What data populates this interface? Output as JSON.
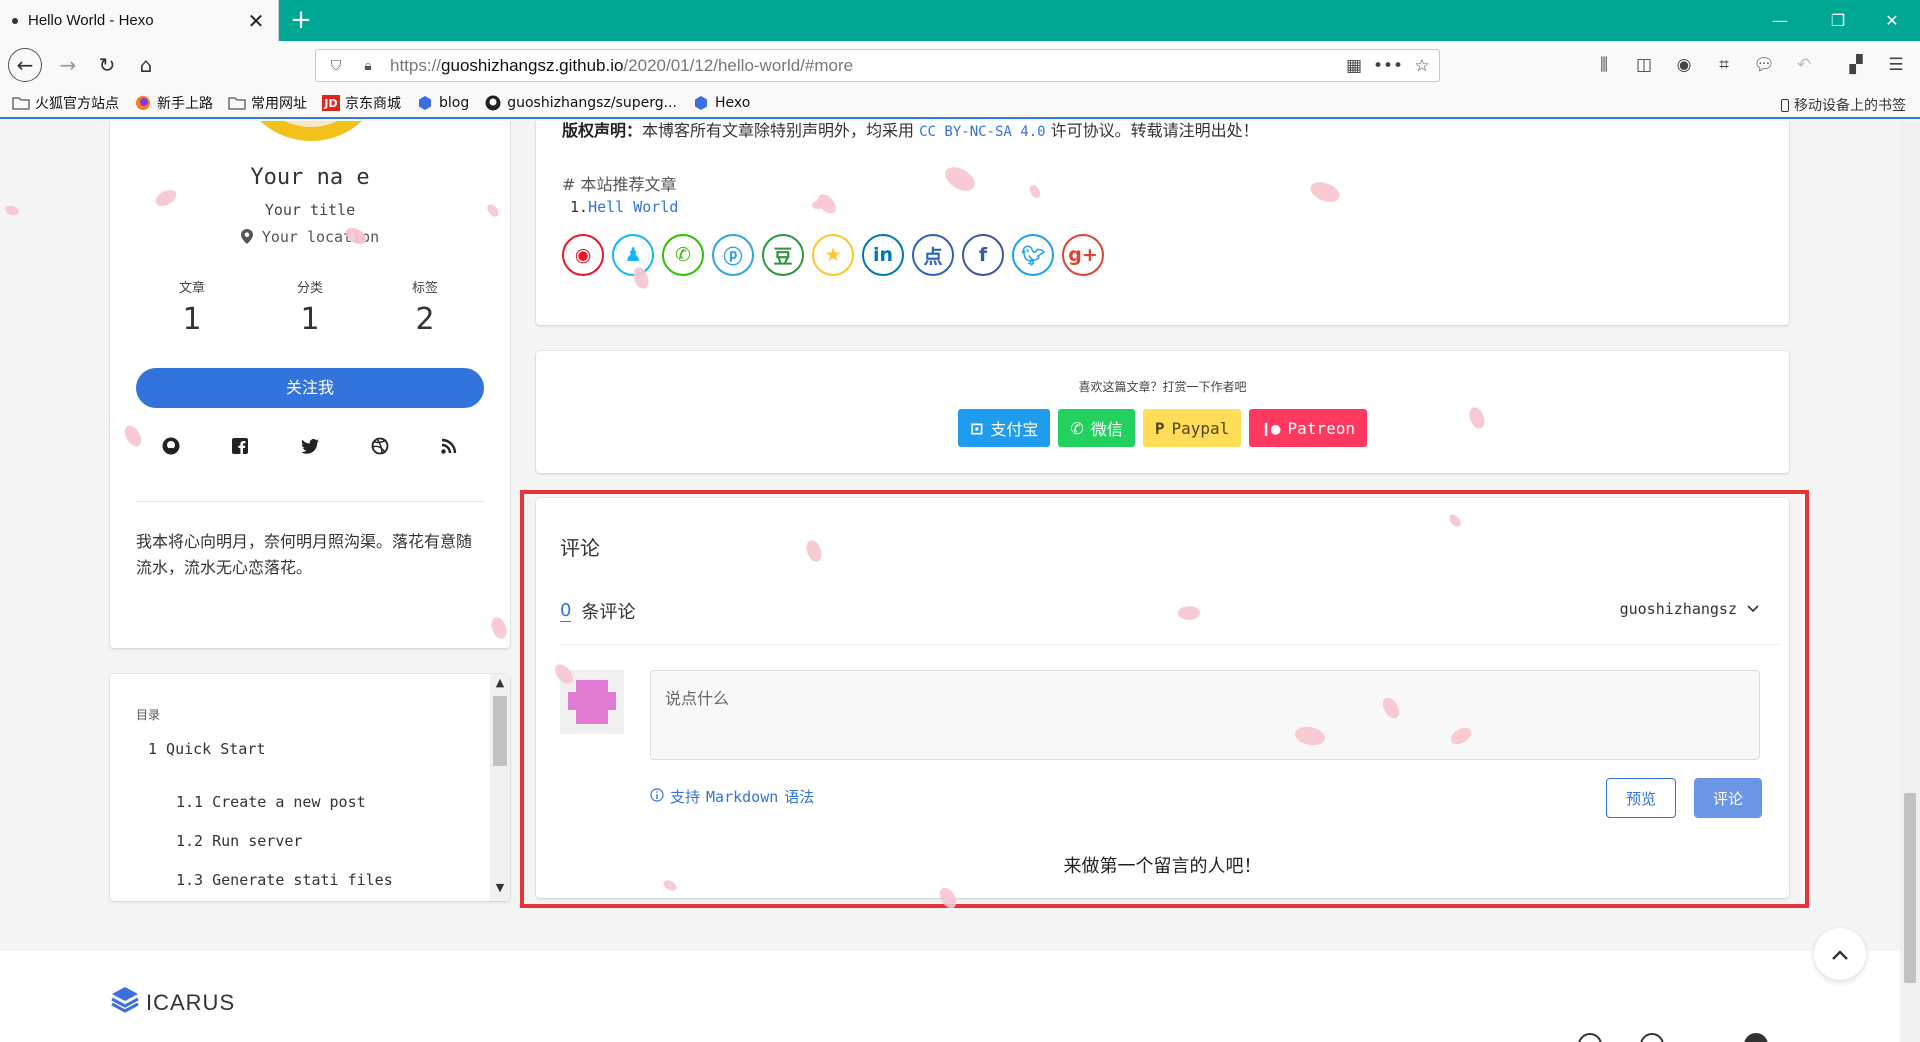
{
  "browser": {
    "tab_title": "Hello World - Hexo",
    "url_prefix": "https://",
    "url_domain": "guoshizhangsz.github.io",
    "url_path": "/2020/01/12/hello-world/#more",
    "bookmarks": [
      {
        "label": "火狐官方站点",
        "icon": "folder-icon"
      },
      {
        "label": "新手上路",
        "icon": "firefox-icon"
      },
      {
        "label": "常用网址",
        "icon": "folder-icon"
      },
      {
        "label": "京东商城",
        "icon": "jd-icon"
      },
      {
        "label": "blog",
        "icon": "hexo-icon"
      },
      {
        "label": "guoshizhangsz/superg...",
        "icon": "github-icon"
      },
      {
        "label": "Hexo",
        "icon": "hexo-icon"
      }
    ],
    "mobile_bookmarks": "移动设备上的书签"
  },
  "profile": {
    "name": "Your na e",
    "title": "Your title",
    "location": "Your location",
    "stats": [
      {
        "label": "文章",
        "value": "1"
      },
      {
        "label": "分类",
        "value": "1"
      },
      {
        "label": "标签",
        "value": "2"
      }
    ],
    "follow_label": "关注我",
    "socials": [
      "github-icon",
      "facebook-icon",
      "twitter-icon",
      "dribbble-icon",
      "rss-icon"
    ],
    "motto": "我本将心向明月，奈何明月照沟渠。落花有意随流水，流水无心恋落花。"
  },
  "toc": {
    "label": "目录",
    "items": [
      "1 Quick Start",
      "1.1 Create a new post",
      "1.2 Run server",
      "1.3 Generate stati  files"
    ]
  },
  "article": {
    "copyright_label": "版权声明：",
    "copyright_text": "本博客所有文章除特别声明外，均采用",
    "license": "CC BY-NC-SA 4.0",
    "copyright_tail": "许可协议。转载请注明出处！",
    "recommend_title": "# 本站推荐文章",
    "recommend_index": "1.",
    "recommend_link": "Hell  World",
    "share_icons": [
      "weibo-icon",
      "qq-icon",
      "wechat-icon",
      "qzone-icon",
      "douban-icon",
      "qqzone-star-icon",
      "linkedin-icon",
      "dianping-icon",
      "facebook-icon",
      "twitter-icon",
      "googleplus-icon"
    ]
  },
  "donate": {
    "label": "喜欢这篇文章？打赏一下作者吧",
    "buttons": [
      {
        "label": "支付宝",
        "color": "#209cee"
      },
      {
        "label": "微信",
        "color": "#23d160"
      },
      {
        "label": "Paypal",
        "color": "#ffdd57"
      },
      {
        "label": "Patreon",
        "color": "#ff3860"
      }
    ]
  },
  "comments": {
    "title": "评论",
    "count": "0",
    "count_label": "条评论",
    "user": "guoshizhangsz",
    "placeholder": "说点什么",
    "markdown_note_pre": "支持",
    "markdown_note_mono": "Markdown",
    "markdown_note_post": "语法",
    "preview_label": "预览",
    "submit_label": "评论",
    "empty_text": "来做第一个留言的人吧！",
    "accent": "#3273dc",
    "highlight_color": "#ea3339"
  },
  "footer": {
    "logo_text": "ICARUS"
  }
}
